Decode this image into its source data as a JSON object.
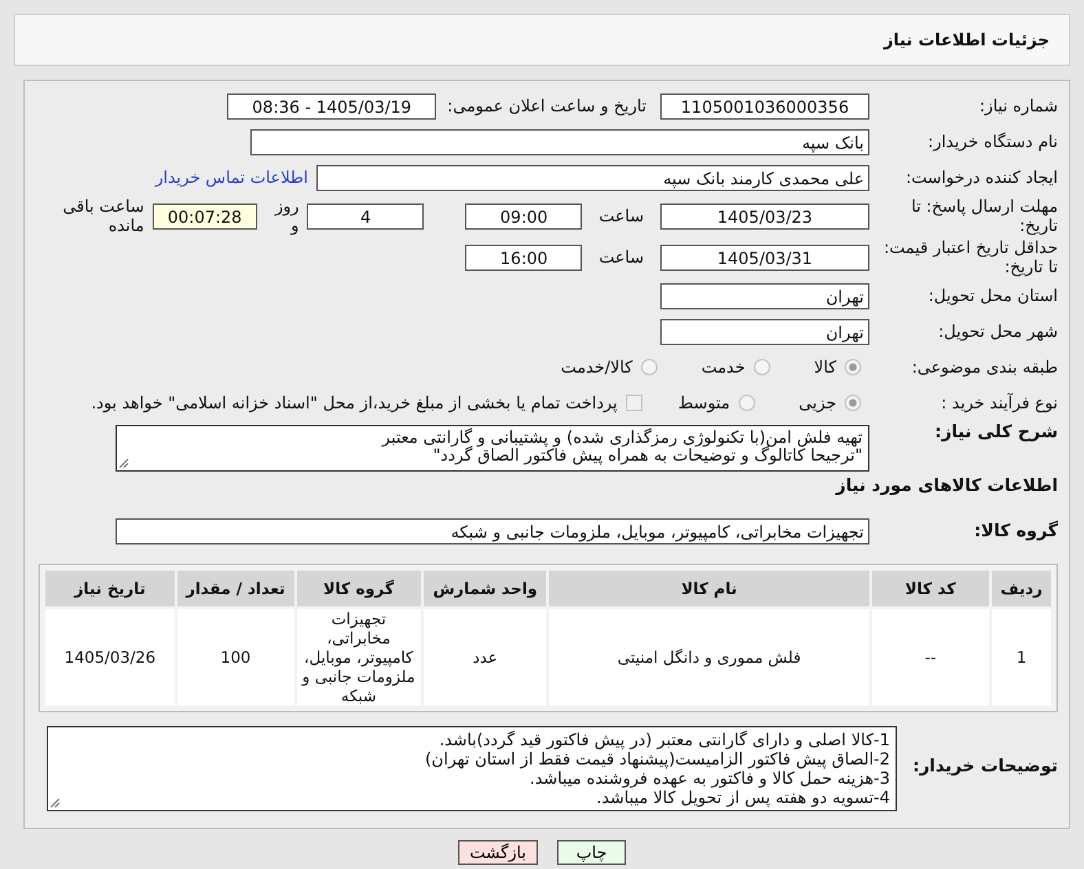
{
  "header": {
    "title": "جزئیات اطلاعات نیاز"
  },
  "need_number": {
    "label": "شماره نیاز:",
    "value": "1105001036000356"
  },
  "announce": {
    "label": "تاریخ و ساعت اعلان عمومی:",
    "value": "1405/03/19 - 08:36"
  },
  "buyer_org": {
    "label": "نام دستگاه خریدار:",
    "value": "بانک سپه"
  },
  "requester": {
    "label": "ایجاد کننده درخواست:",
    "value": "علی محمدی کارمند بانک سپه",
    "link": "اطلاعات تماس خریدار"
  },
  "deadline": {
    "label": "مهلت ارسال پاسخ: تا تاریخ:",
    "date": "1405/03/23",
    "time_label": "ساعت",
    "time": "09:00",
    "days": "4",
    "days_label": "روز و",
    "remaining": "00:07:28",
    "remaining_label": "ساعت باقی مانده"
  },
  "validity": {
    "label": "حداقل تاریخ اعتبار قیمت: تا تاریخ:",
    "date": "1405/03/31",
    "time_label": "ساعت",
    "time": "16:00"
  },
  "province": {
    "label": "استان محل تحویل:",
    "value": "تهران"
  },
  "city": {
    "label": "شهر محل تحویل:",
    "value": "تهران"
  },
  "category": {
    "label": "طبقه بندی موضوعی:",
    "options": [
      {
        "label": "کالا",
        "selected": true
      },
      {
        "label": "خدمت",
        "selected": false
      },
      {
        "label": "کالا/خدمت",
        "selected": false
      }
    ]
  },
  "purchase_type": {
    "label": "نوع فرآیند خرید :",
    "options": [
      {
        "label": "جزیی",
        "selected": true
      },
      {
        "label": "متوسط",
        "selected": false
      }
    ],
    "payment_checkbox": {
      "checked": false,
      "label": "پرداخت تمام یا بخشی از مبلغ خرید،از محل \"اسناد خزانه اسلامی\" خواهد بود."
    }
  },
  "description": {
    "label": "شرح کلی نیاز:",
    "lines": [
      "تهیه فلش امن(با تکنولوژی رمزگذاری شده) و پشتیبانی و گارانتی معتبر",
      "\"ترجیحا کاتالوگ و توضیحات به همراه پیش فاکتور الصاق گردد\""
    ]
  },
  "goods_title": "اطلاعات کالاهای مورد نیاز",
  "goods_group": {
    "label": "گروه کالا:",
    "value": "تجهیزات مخابراتی، کامپیوتر، موبایل، ملزومات جانبی و شبکه"
  },
  "table": {
    "columns": [
      "ردیف",
      "کد کالا",
      "نام کالا",
      "واحد شمارش",
      "گروه کالا",
      "تعداد / مقدار",
      "تاریخ نیاز"
    ],
    "rows": [
      [
        "1",
        "--",
        "فلش مموری و دانگل امنیتی",
        "عدد",
        "تجهیزات مخابراتی، کامپیوتر، موبایل، ملزومات جانبی و شبکه",
        "100",
        "1405/03/26"
      ]
    ]
  },
  "buyer_notes": {
    "label": "توضیحات خریدار:",
    "lines": [
      "1-کالا اصلی و دارای گارانتی معتبر (در پیش فاکتور قید گردد)باشد.",
      "2-الصاق پیش فاکتور الزامیست(پیشنهاد قیمت فقط از استان تهران)",
      "3-هزینه حمل کالا و فاکتور به عهده فروشنده میباشد.",
      "4-تسویه دو هفته پس از تحویل کالا میباشد."
    ]
  },
  "buttons": [
    {
      "label": "چاپ",
      "kind": "print"
    },
    {
      "label": "بازگشت",
      "kind": "back"
    }
  ]
}
